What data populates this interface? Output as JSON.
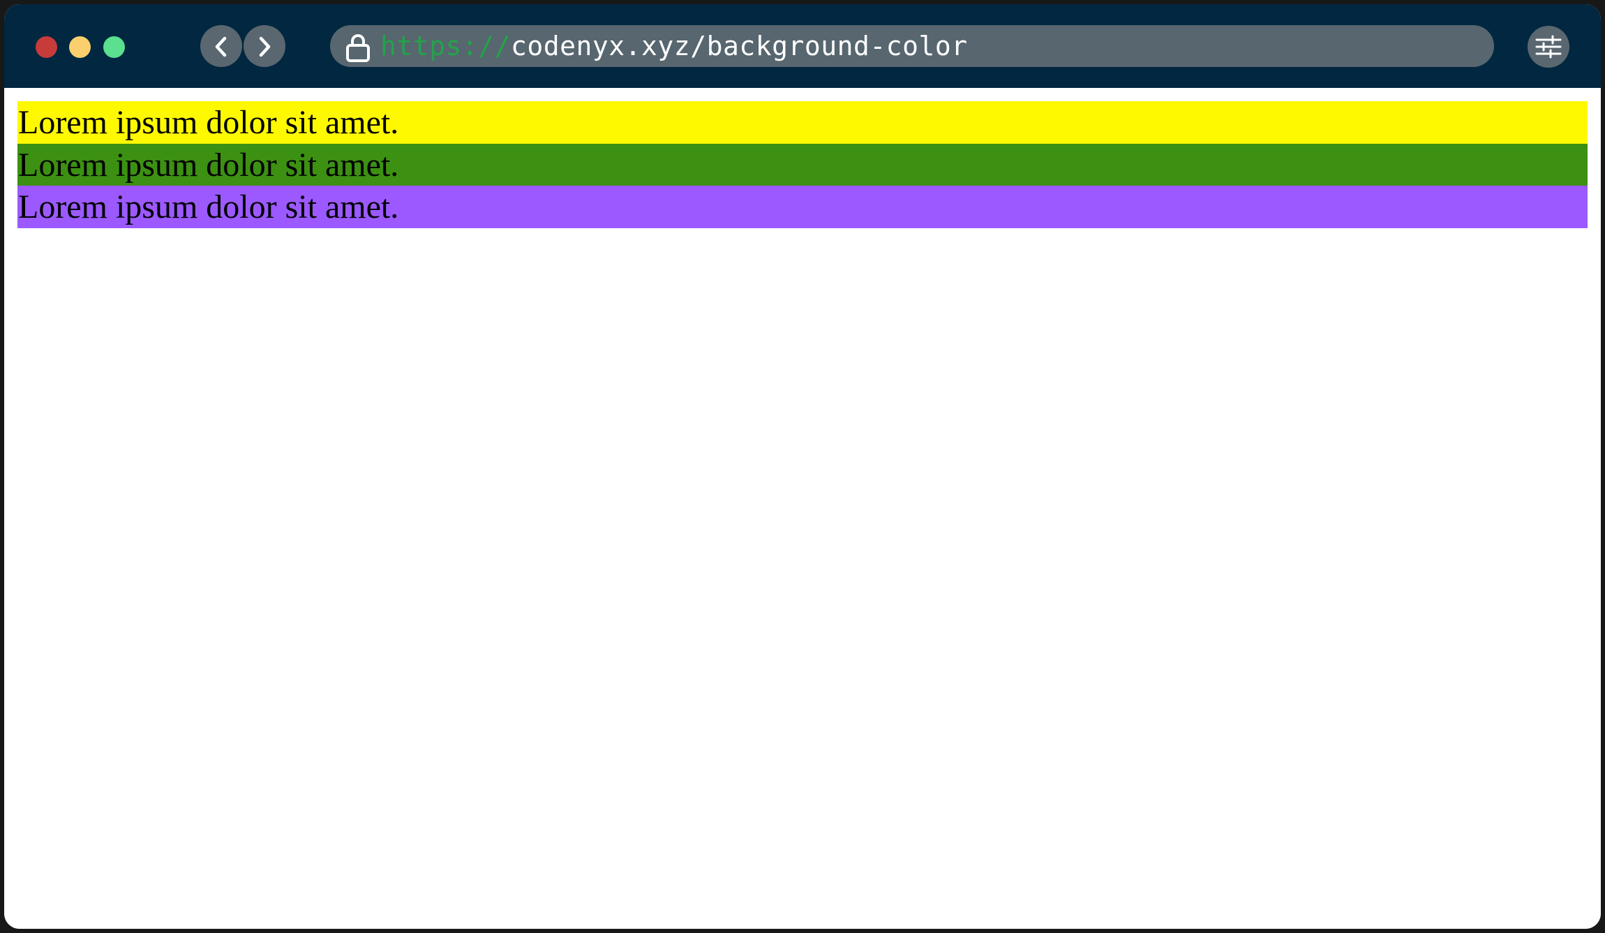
{
  "browser": {
    "url_scheme": "https://",
    "url_path": "codenyx.xyz/background-color",
    "colors": {
      "titlebar": "#022740",
      "close": "#c73b3b",
      "minimize": "#fbcf6e",
      "maximize": "#5ae08f",
      "url_scheme": "#22a34a"
    }
  },
  "page": {
    "rows": [
      {
        "text": "Lorem ipsum dolor sit amet.",
        "background": "#fff900"
      },
      {
        "text": "Lorem ipsum dolor sit amet.",
        "background": "#3c9012"
      },
      {
        "text": "Lorem ipsum dolor sit amet.",
        "background": "#9b59ff"
      }
    ]
  }
}
